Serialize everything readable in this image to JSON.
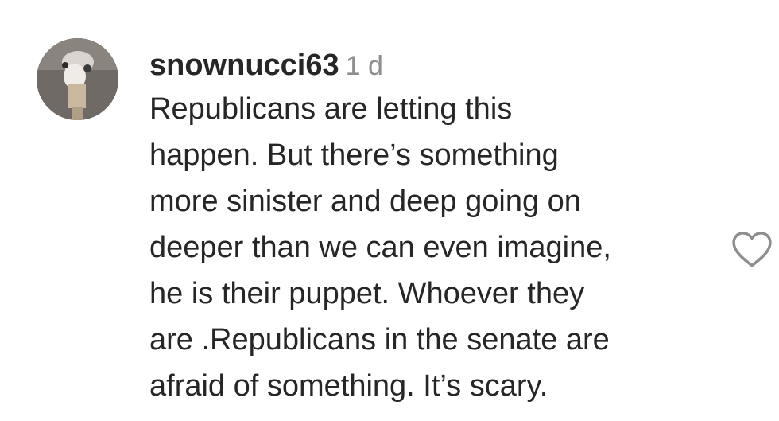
{
  "comment": {
    "username": "snownucci63",
    "timestamp": "1 d",
    "lines": [
      "Republicans are letting this",
      "happen. But there’s something",
      "more sinister and deep going on",
      "deeper than we can even imagine,",
      "he is their puppet. Whoever they",
      "are .Republicans in the senate are",
      "afraid of something. It’s scary."
    ],
    "avatar_icon": "user-avatar",
    "like_icon": "heart-outline-icon"
  },
  "colors": {
    "text": "#262626",
    "secondary_text": "#8e8e8e",
    "icon_stroke": "#8e8e8e"
  }
}
